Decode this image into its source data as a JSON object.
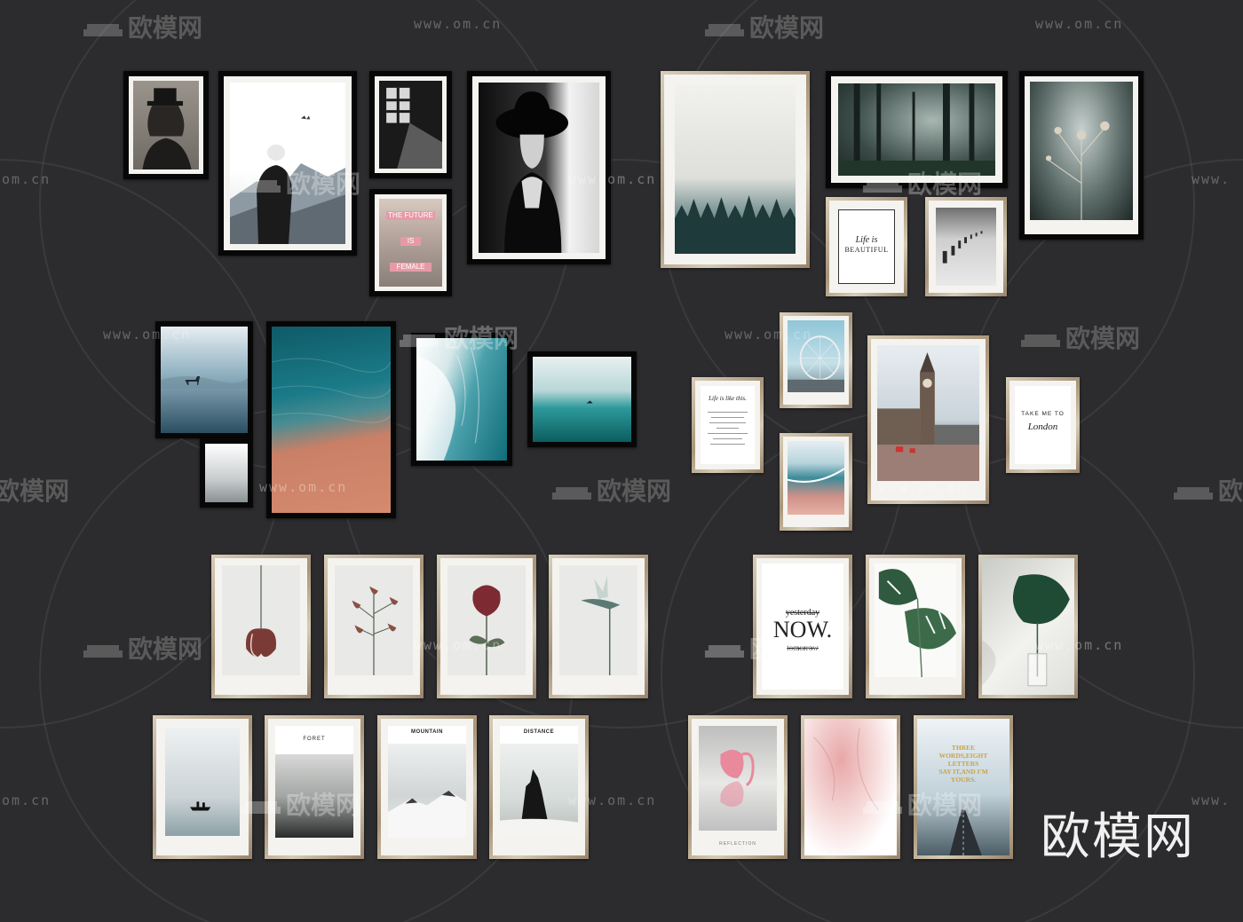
{
  "watermark": {
    "brand": "欧模网",
    "url": "www.om.cn",
    "url_short": "om.cn",
    "url_partial": "www.",
    "brand_partial": "欧模网",
    "corner_brand": "欧模网"
  },
  "posters": {
    "future": [
      "THE FUTURE",
      "IS",
      "FEMALE"
    ],
    "life_beautiful": [
      "Life is",
      "BEAUTIFUL"
    ],
    "life_like_this": "Life is like this.",
    "take_me": "TAKE ME TO",
    "london": "London",
    "yesterday": "yesterday",
    "now": "NOW.",
    "tomorrow": "tomorrow",
    "foret": "FORET",
    "mountain": "MOUNTAIN",
    "distance": "DISTANCE",
    "reflection": "REFLECTION",
    "three_words": [
      "THREE",
      "WORDS,EIGHT",
      "LETTERS",
      "SAY IT,AND I'M",
      "YOURS."
    ]
  },
  "colors": {
    "background": "#2c2c2e",
    "black_frame": "#070707",
    "wood_frame": "#b8a78c",
    "pink_accent": "#e79aa6",
    "gold_text": "#c9a24a"
  }
}
